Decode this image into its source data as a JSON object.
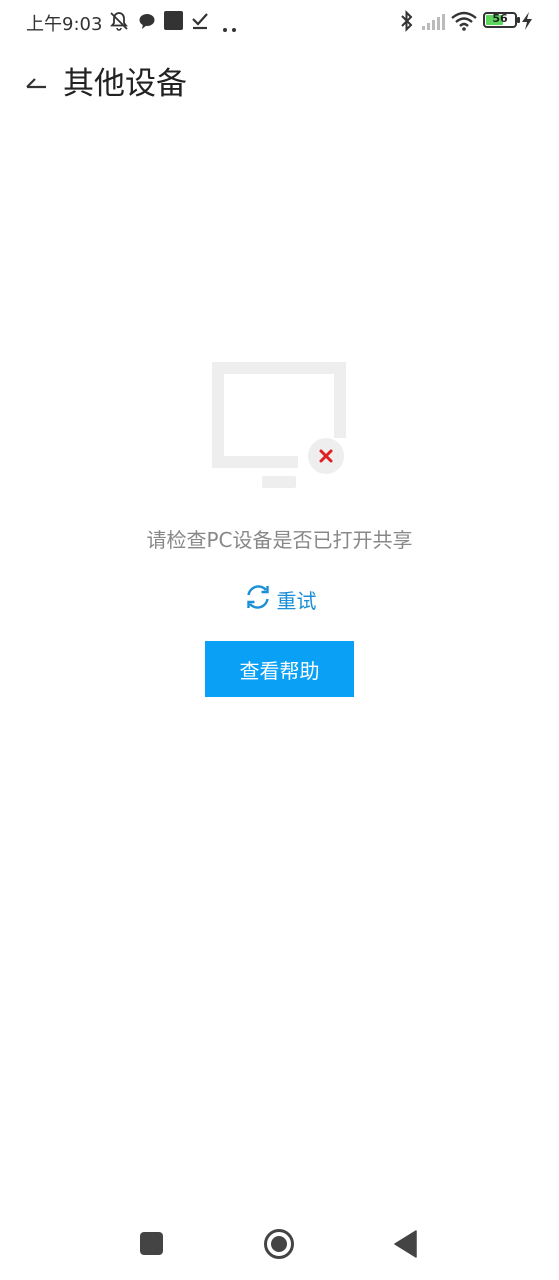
{
  "status_bar": {
    "time": "上午9:03",
    "battery_level": "56",
    "battery_fraction": 0.56,
    "icons": [
      "mute-bell-icon",
      "chat-bubble-icon",
      "square-app-icon",
      "download-check-icon",
      "more-dots-icon",
      "bluetooth-icon",
      "signal-icon",
      "wifi-icon",
      "battery-icon",
      "charging-bolt-icon"
    ]
  },
  "header": {
    "title": "其他设备",
    "back_icon": "back-arrow-icon"
  },
  "empty_state": {
    "illustration": "monitor-error-icon",
    "message": "请检查PC设备是否已打开共享",
    "retry_label": "重试",
    "retry_icon": "refresh-icon",
    "help_button_label": "查看帮助"
  },
  "nav_bar": {
    "icons": [
      "recents-square-icon",
      "home-circle-icon",
      "back-triangle-icon"
    ]
  },
  "colors": {
    "accent": "#0aa0f5",
    "retry_text": "#1a8fd6",
    "message_text": "#888888",
    "illustration_gray": "#eeeeee",
    "error_red": "#e02020"
  }
}
